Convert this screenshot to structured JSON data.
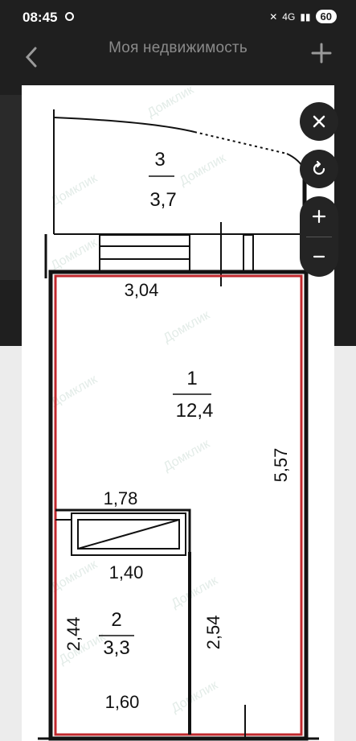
{
  "status": {
    "time": "08:45",
    "battery": "60",
    "network": "4G"
  },
  "appbar": {
    "title": "Моя недвижимость"
  },
  "plan": {
    "watermark": "Домклик",
    "rooms": [
      {
        "number": "3",
        "area": "3,7"
      },
      {
        "number": "1",
        "area": "12,4"
      },
      {
        "number": "2",
        "area": "3,3"
      }
    ],
    "dimensions": {
      "top_width": "3,04",
      "main_length": "5,57",
      "niche_top": "1,78",
      "niche_bottom": "1,40",
      "bath_left": "2,44",
      "bath_right": "2,54",
      "bath_bottom": "1,60"
    }
  },
  "controls": {
    "close": "close-icon",
    "rotate": "rotate-icon",
    "zoom_in": "plus-icon",
    "zoom_out": "minus-icon"
  }
}
